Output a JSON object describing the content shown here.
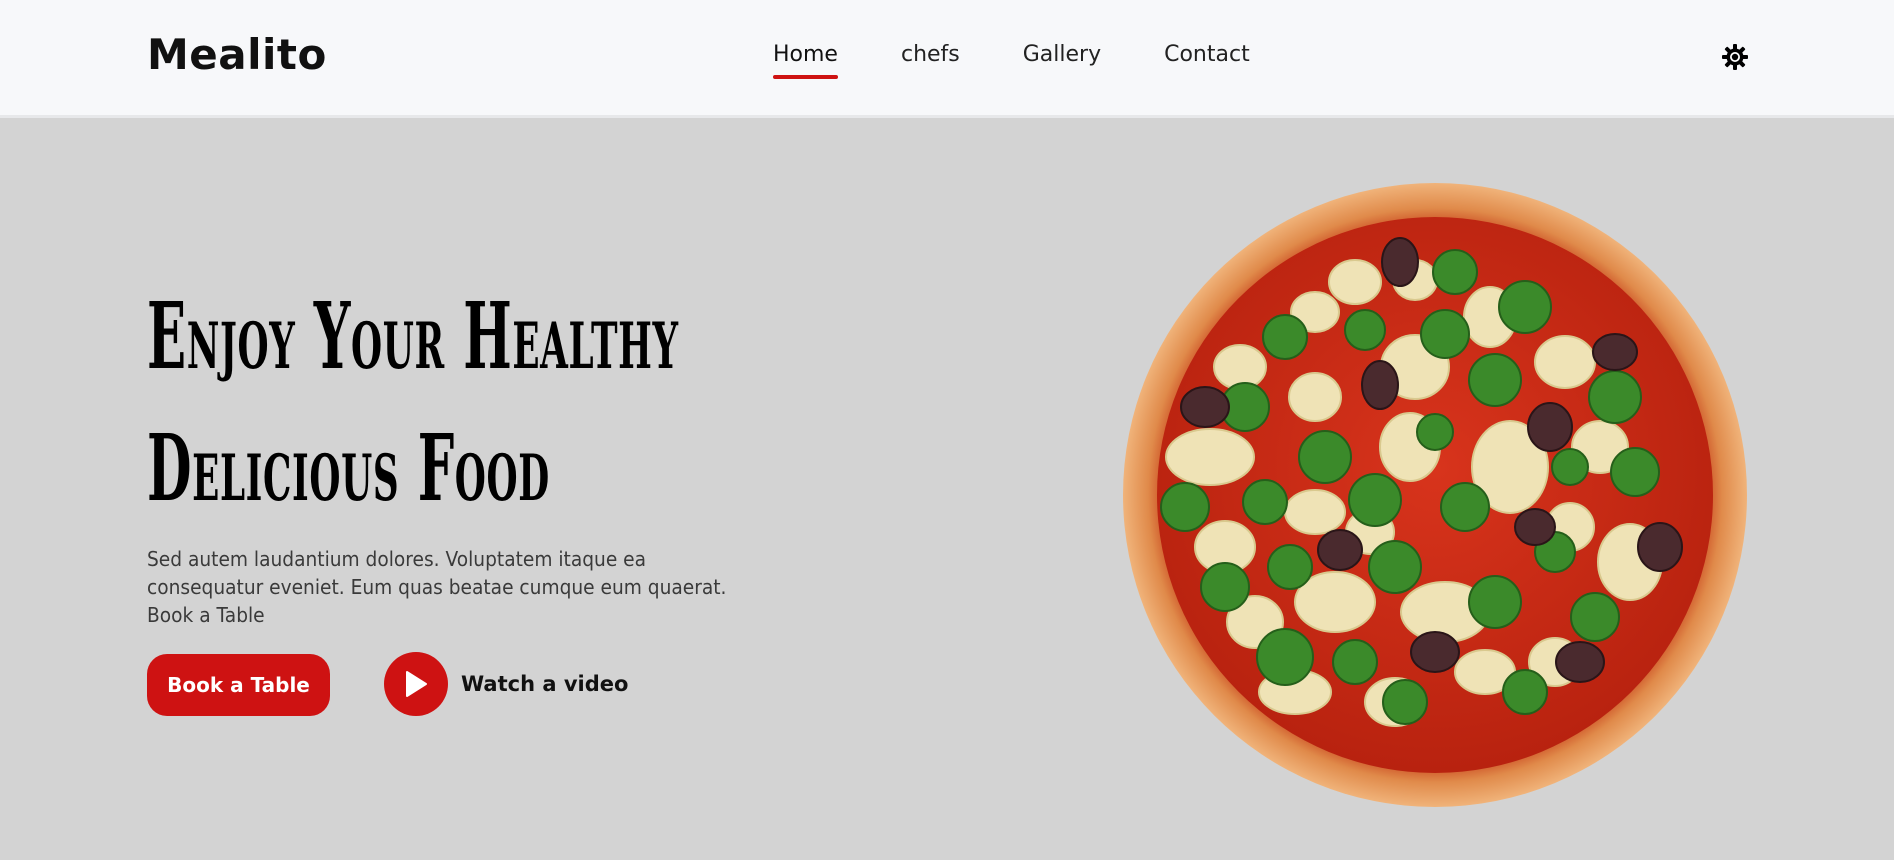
{
  "brand": {
    "name": "Mealito"
  },
  "nav": {
    "items": [
      {
        "label": "Home",
        "active": true
      },
      {
        "label": "chefs",
        "active": false
      },
      {
        "label": "Gallery",
        "active": false
      },
      {
        "label": "Contact",
        "active": false
      }
    ],
    "theme_toggle_icon": "sun-gear-icon"
  },
  "hero": {
    "title_line1": "Enjoy Your Healthy",
    "title_line2": "Delicious Food",
    "description": "Sed autem laudantium dolores. Voluptatem itaque ea consequatur eveniet. Eum quas beatae cumque eum quaerat. Book a Table",
    "book_button": "Book a Table",
    "video_label": "Watch a video",
    "image": "pizza-image"
  },
  "colors": {
    "accent": "#ce1212",
    "header_bg": "#f7f8fa",
    "hero_bg": "#d3d3d3"
  }
}
